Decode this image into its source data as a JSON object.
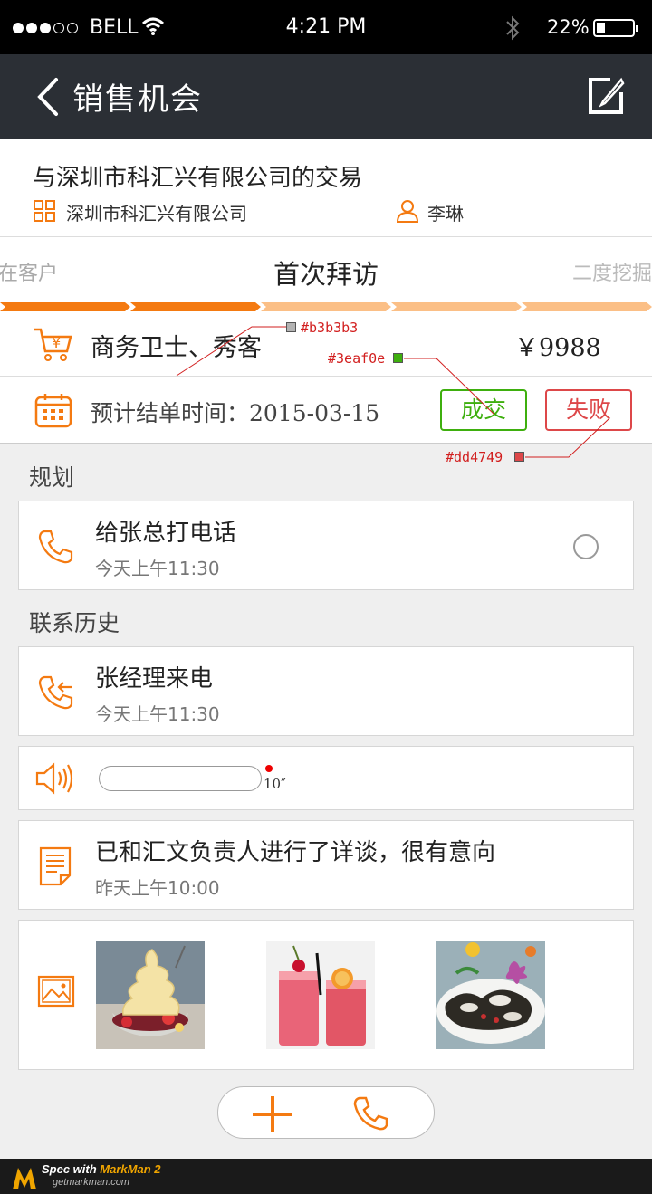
{
  "status_bar": {
    "carrier": "BELL",
    "time": "4:21 PM",
    "battery_pct": "22%",
    "signal_full": 3,
    "signal_total": 5,
    "battery_level": 0.22
  },
  "nav": {
    "title": "销售机会",
    "back_icon": "chevron-left-icon",
    "edit_icon": "edit-icon"
  },
  "deal": {
    "title": "与深圳市科汇兴有限公司的交易",
    "company": "深圳市科汇兴有限公司",
    "contact": "李琳"
  },
  "stage": {
    "prev": "在客户",
    "current": "首次拜访",
    "next": "二度挖掘",
    "progress_segments_done": 2,
    "progress_segments_total": 5,
    "color_done": "#f47a11",
    "color_todo": "#fbbf86"
  },
  "product": {
    "name": "商务卫士、秀客",
    "price": "￥9988"
  },
  "close": {
    "label": "预计结单时间：2015-03-15",
    "won_label": "成交",
    "lost_label": "失败"
  },
  "annotations": {
    "gray": "#b3b3b3",
    "green": "#3eaf0e",
    "red": "#dd4749"
  },
  "plan": {
    "section_title": "规划",
    "task_title": "给张总打电话",
    "task_time": "今天上午11:30"
  },
  "history": {
    "section_title": "联系历史",
    "call_title": "张经理来电",
    "call_time": "今天上午11:30",
    "audio_duration": "10″",
    "note_title": "已和汇文负责人进行了详谈，很有意向",
    "note_time": "昨天上午10:00",
    "photos": [
      "ice-cream-photo",
      "red-drinks-photo",
      "mushroom-dish-photo"
    ]
  },
  "footer": {
    "line1_prefix": "Spec with ",
    "line1_brand": "MarkMan 2",
    "line2": "getmarkman.com"
  },
  "colors": {
    "accent": "#f47a11",
    "nav_bg": "#2b2f35"
  }
}
